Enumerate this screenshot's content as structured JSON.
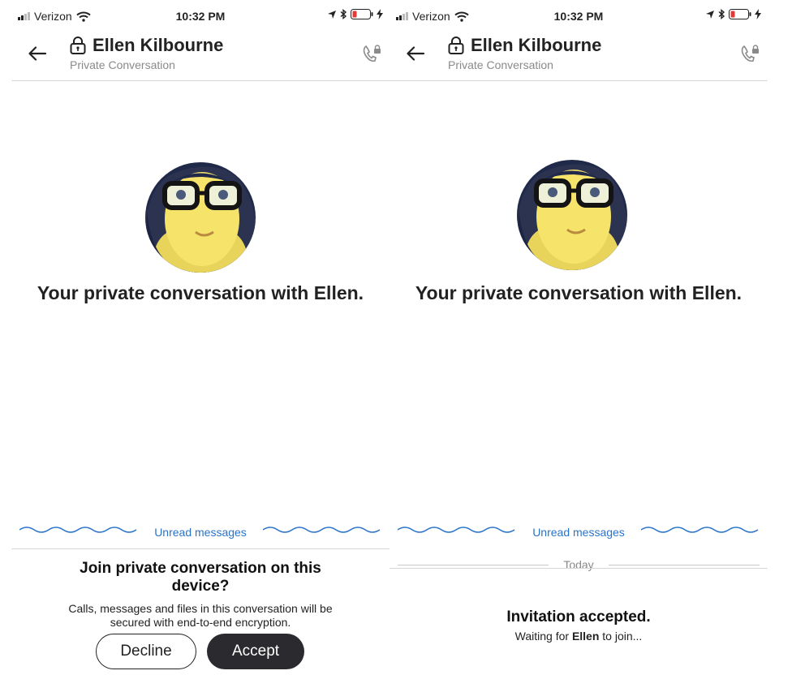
{
  "status": {
    "carrier": "Verizon",
    "time": "10:32 PM"
  },
  "contact": {
    "name": "Ellen Kilbourne",
    "subtitle": "Private Conversation",
    "avatar_alt": "Ellen profile photo"
  },
  "intro": "Your private conversation with Ellen.",
  "unread_label": "Unread messages",
  "invite": {
    "question": "Join private conversation on this device?",
    "description": "Calls, messages and files in this conversation will be secured with end-to-end encryption.",
    "decline_label": "Decline",
    "accept_label": "Accept"
  },
  "today_label": "Today",
  "accepted": {
    "heading": "Invitation accepted.",
    "waiting_prefix": "Waiting for",
    "waiting_name": "Ellen",
    "waiting_suffix": "to join..."
  },
  "colors": {
    "accent": "#2a73c8",
    "dark_button": "#2b2b2f",
    "battery_low": "#e53935"
  },
  "icons": [
    "signal-icon",
    "wifi-icon",
    "location-icon",
    "bluetooth-icon",
    "battery-icon",
    "charging-icon",
    "back-arrow-icon",
    "lock-icon",
    "secure-call-icon"
  ]
}
